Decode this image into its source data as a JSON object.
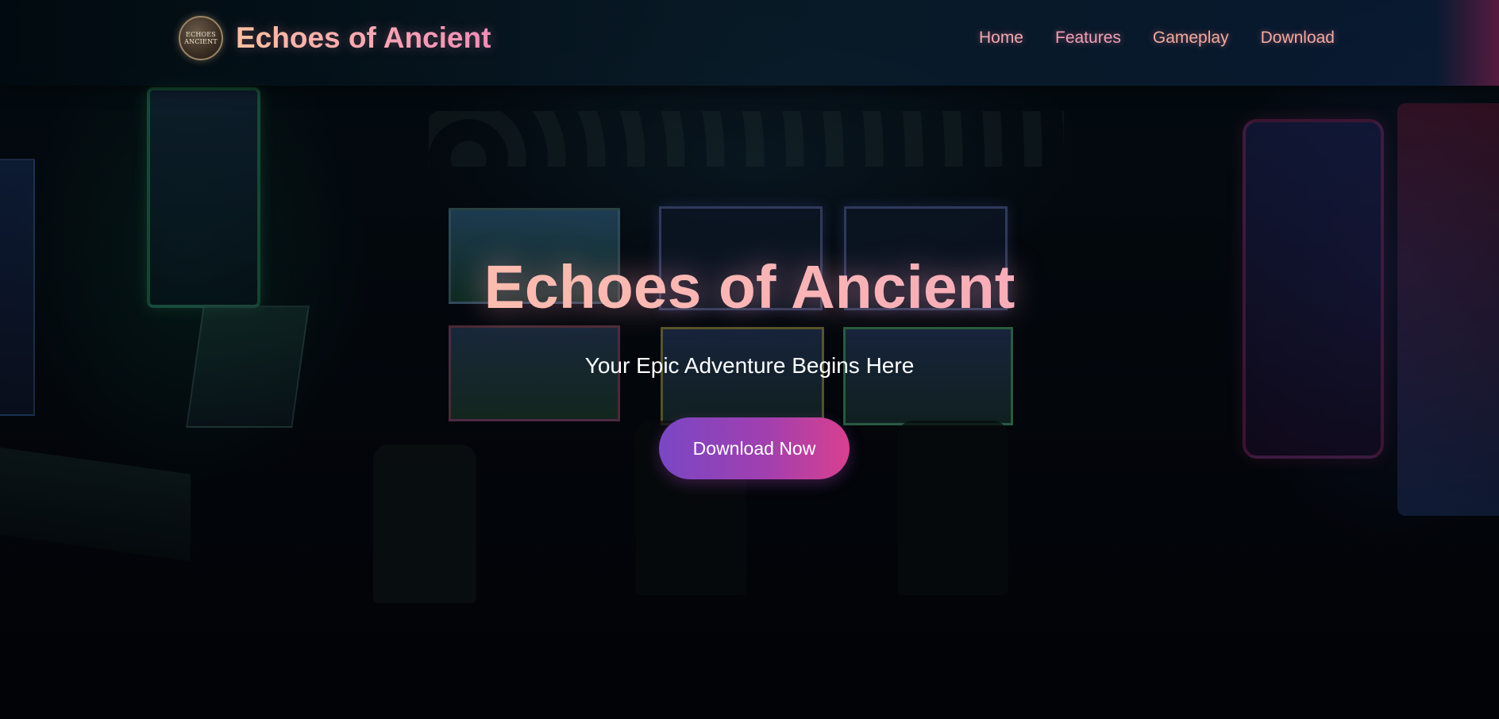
{
  "header": {
    "logo_text": "ECHOES ANCIENT",
    "brand_title": "Echoes of Ancient",
    "nav": [
      {
        "label": "Home"
      },
      {
        "label": "Features"
      },
      {
        "label": "Gameplay"
      },
      {
        "label": "Download"
      }
    ]
  },
  "hero": {
    "title": "Echoes of Ancient",
    "subtitle": "Your Epic Adventure Begins Here",
    "cta_label": "Download Now"
  },
  "colors": {
    "title_gradient_start": "#ffc9a4",
    "title_gradient_end": "#f29fc0",
    "nav_link": "#f0a5ab",
    "cta_gradient_start": "#7a47c4",
    "cta_gradient_end": "#d8408f"
  }
}
